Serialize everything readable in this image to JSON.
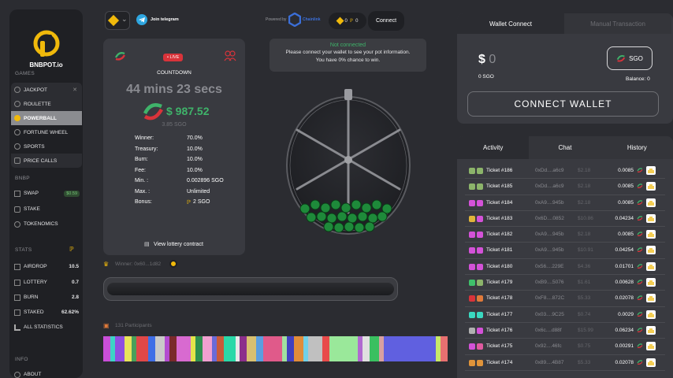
{
  "brand": "BNBPOT.io",
  "sidebar": {
    "games_label": "GAMES",
    "games": [
      {
        "label": "JACKPOT",
        "icon": "jackpot-icon"
      },
      {
        "label": "ROULETTE",
        "icon": "roulette-icon"
      },
      {
        "label": "POWERBALL",
        "icon": "powerball-icon",
        "active": true
      },
      {
        "label": "FORTUNE WHEEL",
        "icon": "wheel-icon"
      },
      {
        "label": "SPORTS",
        "icon": "sports-icon"
      },
      {
        "label": "PRICE CALLS",
        "icon": "price-calls-icon"
      }
    ],
    "bnbp_label": "BNBP",
    "bnbp_items": [
      {
        "label": "SWAP",
        "badge": "$0.59"
      },
      {
        "label": "STAKE"
      },
      {
        "label": "TOKENOMICS"
      }
    ],
    "stats_label": "STATS",
    "stats": [
      {
        "label": "AIRDROP",
        "value": "10.5"
      },
      {
        "label": "LOTTERY",
        "value": "0.7"
      },
      {
        "label": "BURN",
        "value": "2.8"
      },
      {
        "label": "STAKED",
        "value": "62.62%"
      },
      {
        "label": "ALL STATISTICS",
        "value": ""
      }
    ],
    "info_label": "INFO",
    "info_items": [
      {
        "label": "ABOUT"
      }
    ]
  },
  "header": {
    "telegram": "Join telegram",
    "powered_by": "Powered by",
    "chainlink": "Chainlink",
    "balance_bnb": "0",
    "balance_sgo": "0",
    "connect": "Connect"
  },
  "status": {
    "title": "Not connected",
    "line1": "Please connect your wallet to see your pot information.",
    "line2": "You have 0% chance to win."
  },
  "countdown": {
    "live": "• LIVE",
    "label": "COUNTDOWN",
    "timer": "44 mins 23 secs",
    "prize": "$ 987.52",
    "prize_sgo": "3.85 SGO",
    "details": [
      {
        "k": "Winner:",
        "v": "70.0%"
      },
      {
        "k": "Treasury:",
        "v": "10.0%"
      },
      {
        "k": "Burn:",
        "v": "10.0%"
      },
      {
        "k": "Fee:",
        "v": "10.0%"
      },
      {
        "k": "Min. :",
        "v": "0.002896 SGO"
      },
      {
        "k": "Max. :",
        "v": "Unlimited"
      },
      {
        "k": "Bonus:",
        "v": "2 SGO"
      }
    ],
    "contract": "View lottery contract"
  },
  "winner": "Winner: 0x60...1d82",
  "participants": "131 Participants",
  "strip_colors": [
    "#c94fd8",
    "#3dd3c5",
    "#8f4ee0",
    "#e8e35a",
    "#4aa05a",
    "#e04848",
    "#3f6ee6",
    "#c9c9c9",
    "#b34bd0",
    "#7a2a2a",
    "#d86ad0",
    "#e4e44a",
    "#2f8f4f",
    "#f0a0d0",
    "#6a6ad8",
    "#c85a3a",
    "#2ad8a8",
    "#e8e8e8",
    "#8b2f8b",
    "#d8c070",
    "#5a9ee0",
    "#e05a8a",
    "#a0e0a0",
    "#4040c0",
    "#e08c3a",
    "#70d0e8",
    "#c0c0c0",
    "#e84a4a",
    "#9ae89a",
    "#b06ad0",
    "#e0e0e0",
    "#3ac060",
    "#d8a0a0",
    "#6060e0",
    "#c8e868",
    "#e87070"
  ],
  "wallet": {
    "tab_connect": "Wallet Connect",
    "tab_manual": "Manual Transaction",
    "dollar": "$",
    "amount": "0",
    "sgo_amount": "0 SGO",
    "token": "SGO",
    "balance": "Balance: 0",
    "connect_wallet": "CONNECT WALLET"
  },
  "activity": {
    "tabs": [
      "Activity",
      "Chat",
      "History"
    ],
    "rows": [
      {
        "ticket": "Ticket #186",
        "addr": "0xDd....a6c9",
        "usd": "$2.18",
        "amount": "0.0085",
        "c1": "#8cb46a",
        "c2": "#8cb46a"
      },
      {
        "ticket": "Ticket #185",
        "addr": "0xDd....a6c9",
        "usd": "$2.18",
        "amount": "0.0085",
        "c1": "#8cb46a",
        "c2": "#8cb46a"
      },
      {
        "ticket": "Ticket #184",
        "addr": "0xA9....945b",
        "usd": "$2.18",
        "amount": "0.0085",
        "c1": "#d452d8",
        "c2": "#d452d8"
      },
      {
        "ticket": "Ticket #183",
        "addr": "0x6D....0852",
        "usd": "$10.86",
        "amount": "0.04234",
        "c1": "#e0b43a",
        "c2": "#d452d8"
      },
      {
        "ticket": "Ticket #182",
        "addr": "0xA9....945b",
        "usd": "$2.18",
        "amount": "0.0085",
        "c1": "#d452d8",
        "c2": "#d452d8"
      },
      {
        "ticket": "Ticket #181",
        "addr": "0xA9....945b",
        "usd": "$10.91",
        "amount": "0.04254",
        "c1": "#d452d8",
        "c2": "#d452d8"
      },
      {
        "ticket": "Ticket #180",
        "addr": "0x56....229E",
        "usd": "$4.36",
        "amount": "0.01701",
        "c1": "#d452d8",
        "c2": "#d452d8"
      },
      {
        "ticket": "Ticket #179",
        "addr": "0xB9....5076",
        "usd": "$1.61",
        "amount": "0.00628",
        "c1": "#3fc06a",
        "c2": "#8cb46a"
      },
      {
        "ticket": "Ticket #178",
        "addr": "0xF8....872C",
        "usd": "$5.33",
        "amount": "0.02078",
        "c1": "#d9333a",
        "c2": "#e07a3a"
      },
      {
        "ticket": "Ticket #177",
        "addr": "0x03....9C25",
        "usd": "$0.74",
        "amount": "0.0029",
        "c1": "#3ad8c0",
        "c2": "#3ad8c0"
      },
      {
        "ticket": "Ticket #176",
        "addr": "0x6c....d88f",
        "usd": "$15.99",
        "amount": "0.06234",
        "c1": "#b0b0b0",
        "c2": "#d452d8"
      },
      {
        "ticket": "Ticket #175",
        "addr": "0x92....46fc",
        "usd": "$0.75",
        "amount": "0.00291",
        "c1": "#d452d8",
        "c2": "#e05aa0"
      },
      {
        "ticket": "Ticket #174",
        "addr": "0x89....4B87",
        "usd": "$5.33",
        "amount": "0.02078",
        "c1": "#e0943a",
        "c2": "#e0943a"
      }
    ]
  },
  "colors": {
    "accent_green": "#3fb36a",
    "live_red": "#d9333a",
    "brand_yellow": "#f0b90b"
  }
}
